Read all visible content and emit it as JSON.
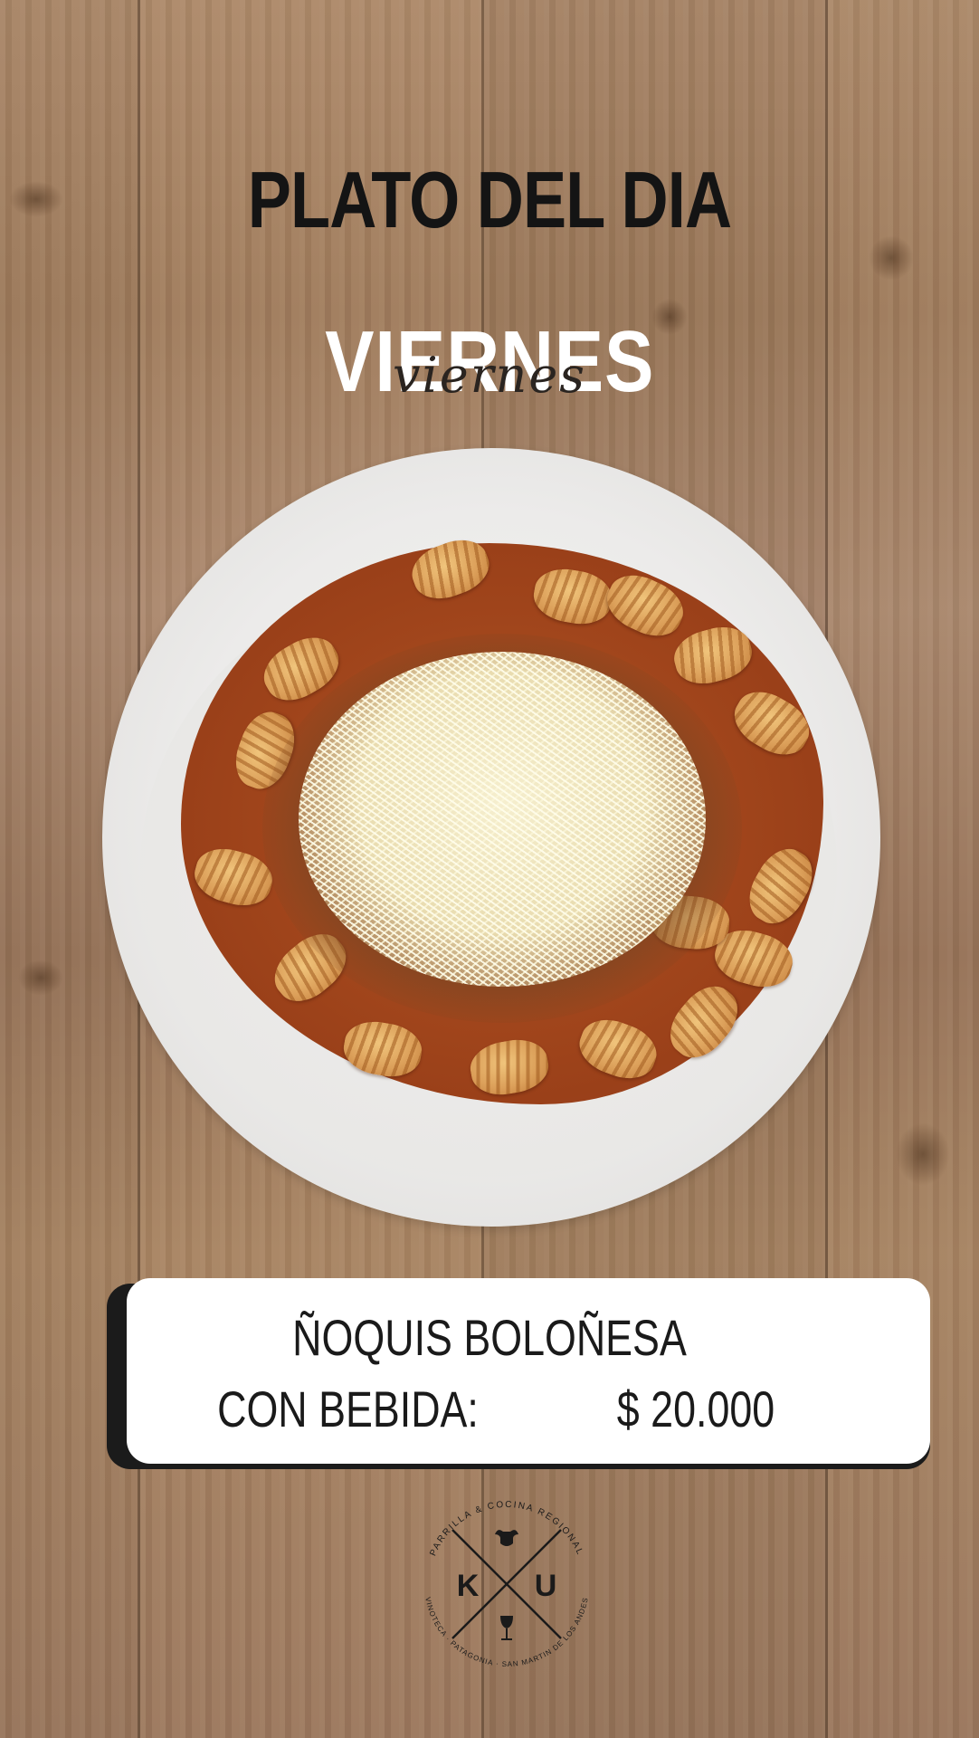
{
  "post": {
    "title": "PLATO DEL DIA",
    "day": "VIERNES",
    "day_script": "viernes"
  },
  "menu_item": {
    "name": "ÑOQUIS BOLOÑESA",
    "price_label": "CON BEBIDA:",
    "price": "$ 20.000"
  },
  "logo": {
    "letter_left": "K",
    "letter_right": "U",
    "ring_text_top": "PARRILLA & COCINA REGIONAL",
    "ring_text_bottom": "VINOTECA · PATAGONIA · SAN MARTIN DE LOS ANDES",
    "icons": [
      "bull-head-icon",
      "wine-glass-icon"
    ]
  },
  "colors": {
    "title": "#141414",
    "day": "#ffffff",
    "card_bg": "#ffffff",
    "card_shadow": "#1b1b1b",
    "wood": "#9a7a5e"
  }
}
